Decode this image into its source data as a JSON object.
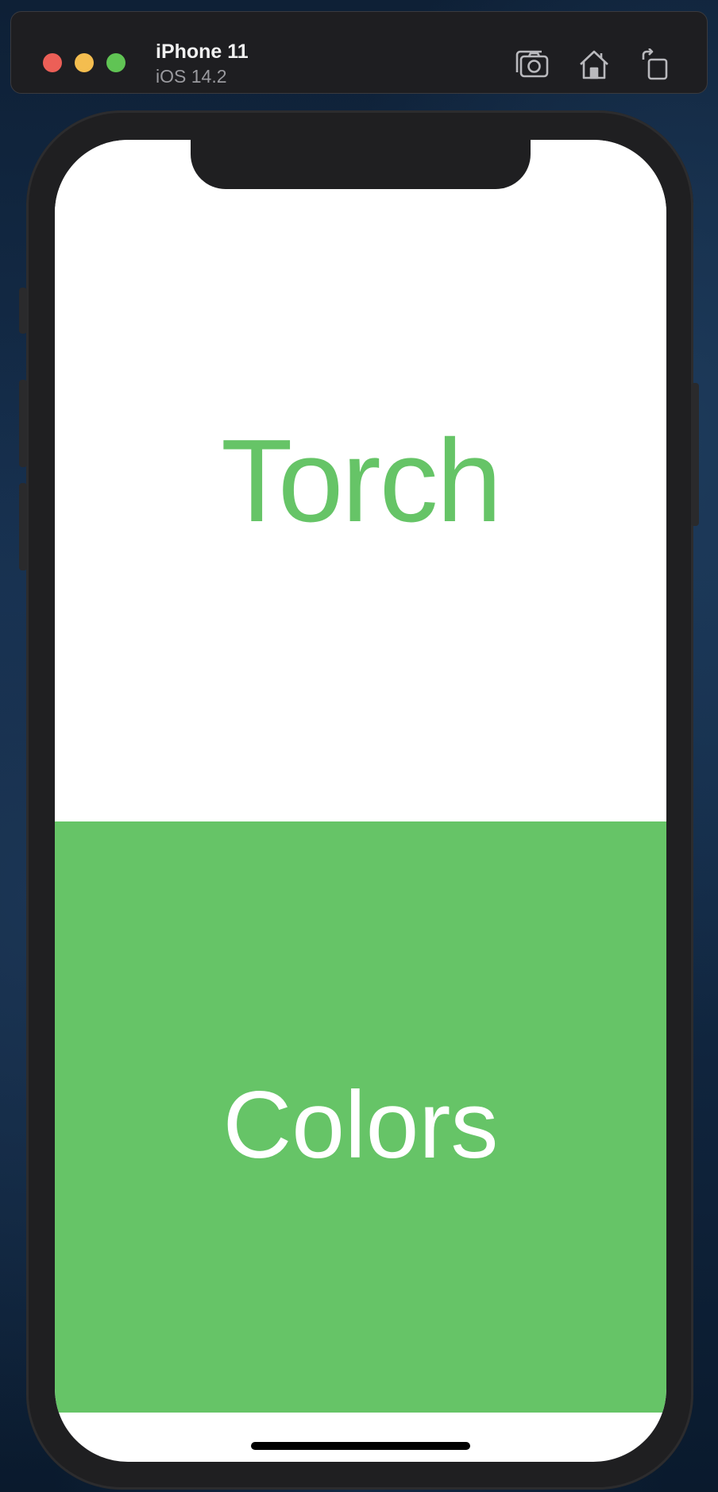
{
  "titlebar": {
    "device_name": "iPhone 11",
    "os_version": "iOS 14.2",
    "traffic_lights": [
      {
        "name": "close",
        "color": "#ec5f57"
      },
      {
        "name": "minimize",
        "color": "#f4bd4f"
      },
      {
        "name": "zoom",
        "color": "#60c454"
      }
    ],
    "icons": [
      "screenshot-icon",
      "home-icon",
      "rotate-icon"
    ]
  },
  "app": {
    "torch_label": "Torch",
    "colors_label": "Colors",
    "accent_color": "#66c467",
    "background_color": "#ffffff"
  }
}
